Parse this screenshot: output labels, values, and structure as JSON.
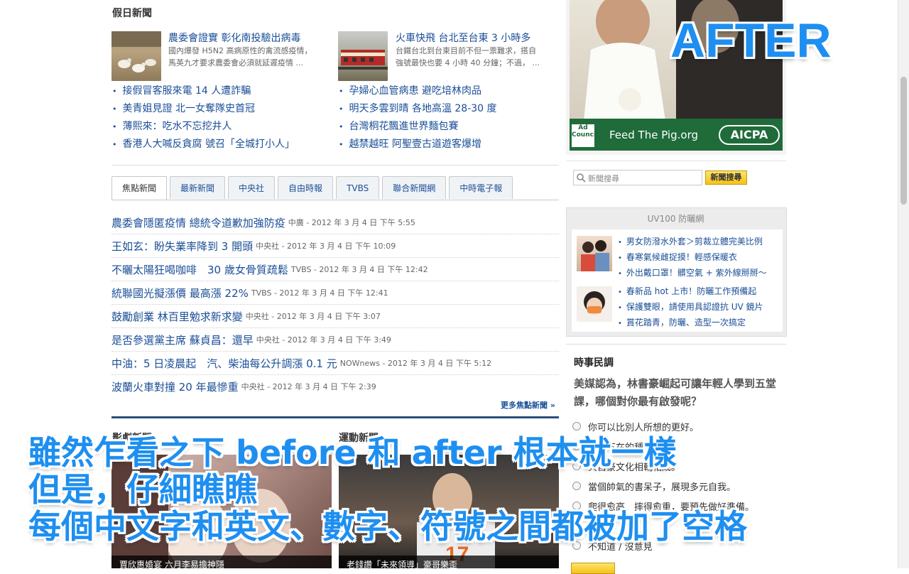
{
  "holiday_news": {
    "title": "假日新聞",
    "leads": [
      {
        "title": "農委會證實 彰化南投驗出病毒",
        "summary1": "國內爆發 H5N2 高病原性的禽流感疫情，",
        "summary2": "馬英九才要求農委會必須就延遲疫情 ..."
      },
      {
        "title": "火車快飛 台北至台東 3 小時多",
        "summary1": "台鐵台北到台東目前不但一票難求，搭自",
        "summary2": "強號最快也要 4 小時 40 分鐘；不過， ..."
      }
    ],
    "left_links": [
      "接假冒客服來電 14 人遭詐騙",
      "美青姐見證 北一女奪隊史首冠",
      "薄熙來：吃水不忘挖井人",
      "香港人大喊反貪腐 號召「全城打小人」"
    ],
    "right_links": [
      "孕婦心血管病患 避吃培林肉品",
      "明天多雲到晴 各地高溫 28-30 度",
      "台灣桐花飄進世界麵包賽",
      "越禁越旺 阿聖壹古道遊客爆增"
    ]
  },
  "tabs": [
    "焦點新聞",
    "最新新聞",
    "中央社",
    "自由時報",
    "TVBS",
    "聯合新聞網",
    "中時電子報"
  ],
  "focus_news": [
    {
      "title": "農委會隱匿疫情 總統令道歉加強防疫",
      "meta": "中廣 - 2012 年 3 月 4 日 下午 5:55"
    },
    {
      "title": "王如玄：盼失業率降到 3 開頭",
      "meta": "中央社 - 2012 年 3 月 4 日 下午 10:09"
    },
    {
      "title": "不曬太陽狂喝咖啡　30 歲女骨質疏鬆",
      "meta": "TVBS - 2012 年 3 月 4 日 下午 12:42"
    },
    {
      "title": "統聯國光擬漲價 最高漲 22%",
      "meta": "TVBS - 2012 年 3 月 4 日 下午 12:41"
    },
    {
      "title": "鼓勵創業 林百里勉求新求變",
      "meta": "中央社 - 2012 年 3 月 4 日 下午 3:07"
    },
    {
      "title": "是否參選黨主席 蘇貞昌：還早",
      "meta": "中央社 - 2012 年 3 月 4 日 下午 3:49"
    },
    {
      "title": "中油：5 日凌晨起　汽、柴油每公升調漲 0.1 元",
      "meta": "NOWnews - 2012 年 3 月 4 日 下午 5:12"
    },
    {
      "title": "波蘭火車對撞 20 年最慘重",
      "meta": "中央社 - 2012 年 3 月 4 日 下午 2:39"
    }
  ],
  "more_focus": "更多焦點新聞 »",
  "ent_news": {
    "title": "影劇新聞",
    "caption": "賈欣惠婚宴 六月李易擔神隱"
  },
  "sport_news": {
    "title": "運動新聞",
    "caption": "老錢讚「未來領導」豪哥樂歪"
  },
  "ad": {
    "text": "Feed The Pig.org",
    "logo_left": "Ad Council",
    "logo_right": "AICPA",
    "badge": "AFTER"
  },
  "search": {
    "placeholder": "新聞搜尋",
    "button": "新聞搜尋"
  },
  "uv": {
    "title": "UV100 防曬網",
    "group1": [
      "男女防潑水外套＞剪裁立體完美比例",
      "春寒氣候雌捉摸！輕感保暖衣",
      "外出戴口罩！髒空氣 + 紫外線掰掰～"
    ],
    "group2": [
      "春新品 hot 上市！防曬工作預備起",
      "保護雙眼，請使用具認證抗 UV 鏡片",
      "賞花踏青，防曬、造型一次搞定"
    ]
  },
  "poll": {
    "title": "時事民調",
    "question": "美媒認為，林書豪崛起可讓年輕人學到五堂課，哪個對你最有啟發呢？",
    "options": [
      "你可以比別人所想的更好。",
      "無所不在的種族歧視。",
      "與自豪文化相輔相成。",
      "當個帥氣的書呆子，展現多元自我。",
      "爬得愈高、摔得愈重，要預先做好準備。",
      "",
      "不知道 / 沒意見"
    ],
    "option_partials": [
      "",
      "無所不在",
      "與自豪",
      "",
      "",
      "",
      ""
    ],
    "option_tails": [
      "",
      "族歧視。",
      "輔相成。",
      "",
      "",
      "",
      ""
    ]
  },
  "overlay": {
    "line1": "雖然乍看之下 before 和 after 根本就一樣",
    "line2": "但是，仔細瞧瞧",
    "line3": "每個中文字和英文、數字、符號之間都被加了空格"
  }
}
